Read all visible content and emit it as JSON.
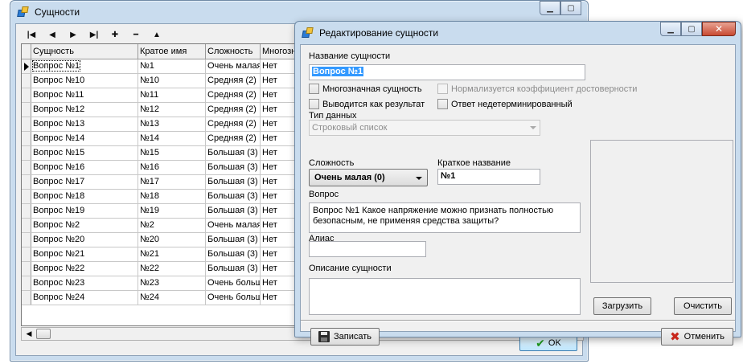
{
  "main_window": {
    "title": "Сущности",
    "nav": {
      "first": "|◀",
      "prev": "◀",
      "next": "▶",
      "last": "▶|",
      "add": "✚",
      "delete": "━",
      "edit": "▲"
    },
    "columns": [
      "Сущность",
      "Кратое имя",
      "Сложность",
      "Многозн"
    ],
    "rows": [
      [
        "Вопрос №1",
        "№1",
        "Очень малая",
        "Нет"
      ],
      [
        "Вопрос №10",
        "№10",
        "Средняя (2)",
        "Нет"
      ],
      [
        "Вопрос №11",
        "№11",
        "Средняя (2)",
        "Нет"
      ],
      [
        "Вопрос №12",
        "№12",
        "Средняя (2)",
        "Нет"
      ],
      [
        "Вопрос №13",
        "№13",
        "Средняя (2)",
        "Нет"
      ],
      [
        "Вопрос №14",
        "№14",
        "Средняя (2)",
        "Нет"
      ],
      [
        "Вопрос №15",
        "№15",
        "Большая (3)",
        "Нет"
      ],
      [
        "Вопрос №16",
        "№16",
        "Большая (3)",
        "Нет"
      ],
      [
        "Вопрос №17",
        "№17",
        "Большая (3)",
        "Нет"
      ],
      [
        "Вопрос №18",
        "№18",
        "Большая (3)",
        "Нет"
      ],
      [
        "Вопрос №19",
        "№19",
        "Большая (3)",
        "Нет"
      ],
      [
        "Вопрос №2",
        "№2",
        "Очень малая",
        "Нет"
      ],
      [
        "Вопрос №20",
        "№20",
        "Большая (3)",
        "Нет"
      ],
      [
        "Вопрос №21",
        "№21",
        "Большая (3)",
        "Нет"
      ],
      [
        "Вопрос №22",
        "№22",
        "Большая (3)",
        "Нет"
      ],
      [
        "Вопрос №23",
        "№23",
        "Очень больш",
        "Нет"
      ],
      [
        "Вопрос №24",
        "№24",
        "Очень больш",
        "Нет"
      ]
    ],
    "selected_row": 0,
    "ok_label": "OK"
  },
  "dialog": {
    "title": "Редактирование сущности",
    "name_label": "Название сущности",
    "name_value": "Вопрос №1",
    "multivalued_label": "Многозначная сущность",
    "normalized_label": "Нормализуется коэффициент достоверности",
    "as_result_label": "Выводится как результат",
    "nondetermined_label": "Ответ недетерминированный",
    "data_type_label": "Тип данных",
    "data_type_value": "Строковый список",
    "complexity_label": "Сложность",
    "complexity_value": "Очень малая (0)",
    "short_name_label": "Краткое название",
    "short_name_value": "№1",
    "question_label": "Вопрос",
    "question_value": "Вопрос №1  Какое напряжение можно признать полностью безопасным, не применяя средства защиты?",
    "alias_label": "Алиас",
    "alias_value": "",
    "description_label": "Описание сущности",
    "description_value": "",
    "load_label": "Загрузить",
    "clear_label": "Очистить",
    "save_label": "Записать",
    "cancel_label": "Отменить"
  }
}
